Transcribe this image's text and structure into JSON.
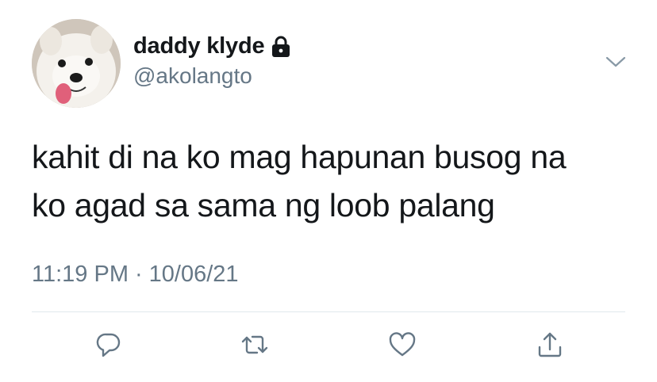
{
  "user": {
    "display_name": "daddy klyde",
    "handle": "@akolangto",
    "protected_icon": "lock-icon",
    "avatar": "dog-avatar"
  },
  "tweet": {
    "text_line1": "kahit di na ko mag hapunan busog na",
    "text_line2": "ko agad sa sama ng loob palang",
    "time": "11:19 PM",
    "separator": "·",
    "date": "10/06/21"
  },
  "actions": {
    "reply_icon": "reply-icon",
    "retweet_icon": "retweet-icon",
    "like_icon": "heart-icon",
    "share_icon": "share-icon"
  },
  "colors": {
    "text_primary": "#14171a",
    "text_secondary": "#657786",
    "divider": "#e1e8ed",
    "icon": "#657786"
  }
}
